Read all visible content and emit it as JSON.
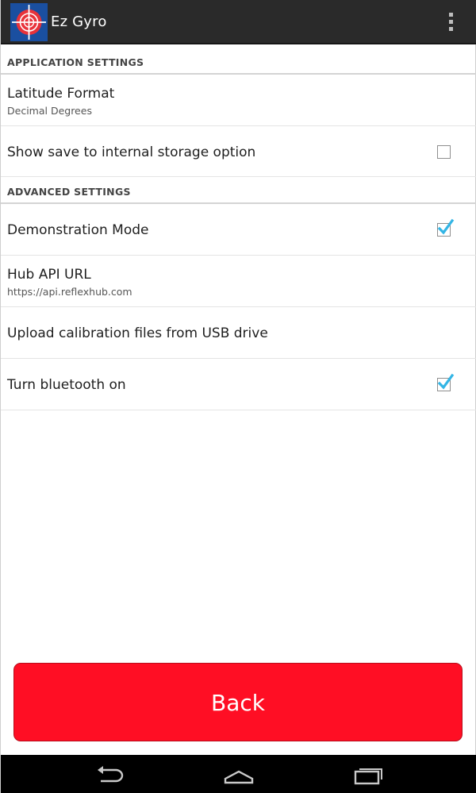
{
  "app": {
    "title": "Ez Gyro",
    "icon": "crosshair-logo",
    "overflow_icon": "overflow-menu-icon"
  },
  "sections": {
    "application": {
      "label": "APPLICATION SETTINGS"
    },
    "advanced": {
      "label": "ADVANCED SETTINGS"
    }
  },
  "prefs": {
    "latitude_format": {
      "title": "Latitude Format",
      "summary": "Decimal Degrees"
    },
    "save_internal": {
      "title": "Show save to internal storage option",
      "checked": false
    },
    "demo_mode": {
      "title": "Demonstration Mode",
      "checked": true
    },
    "hub_api": {
      "title": "Hub API URL",
      "summary": "https://api.reflexhub.com"
    },
    "upload_usb": {
      "title": "Upload calibration files from USB drive"
    },
    "bluetooth": {
      "title": "Turn bluetooth on",
      "checked": true
    }
  },
  "back_button": {
    "label": "Back"
  },
  "colors": {
    "action_bar": "#2a2a2a",
    "back_button": "#ff0e24",
    "checkmark": "#33b5e5",
    "nav_bar": "#000000"
  },
  "nav": {
    "back_icon": "nav-back-icon",
    "home_icon": "nav-home-icon",
    "recents_icon": "nav-recents-icon"
  }
}
